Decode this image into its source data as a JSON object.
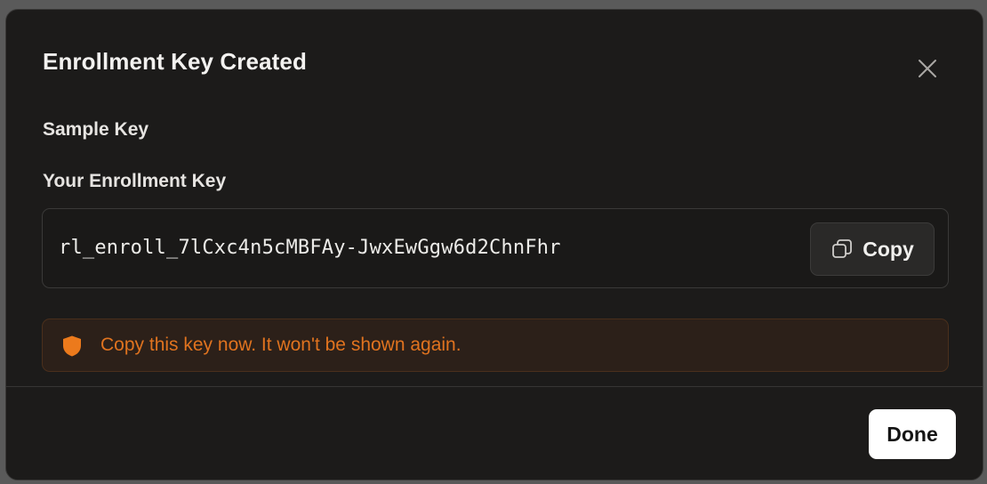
{
  "dialog": {
    "title": "Enrollment Key Created",
    "key_name": "Sample Key",
    "key_label": "Your Enrollment Key",
    "key_value": "rl_enroll_7lCxc4n5cMBFAy-JwxEwGgw6d2ChnFhr",
    "copy_label": "Copy",
    "warning_text": "Copy this key now. It won't be shown again.",
    "done_label": "Done",
    "icons": {
      "close": "close-icon",
      "copy": "copy-icon",
      "warning": "shield-icon"
    },
    "colors": {
      "background": "#1c1b1a",
      "warning_text": "#e0731f",
      "warning_icon": "#ec7a1c",
      "done_button": "#ffffff"
    }
  }
}
